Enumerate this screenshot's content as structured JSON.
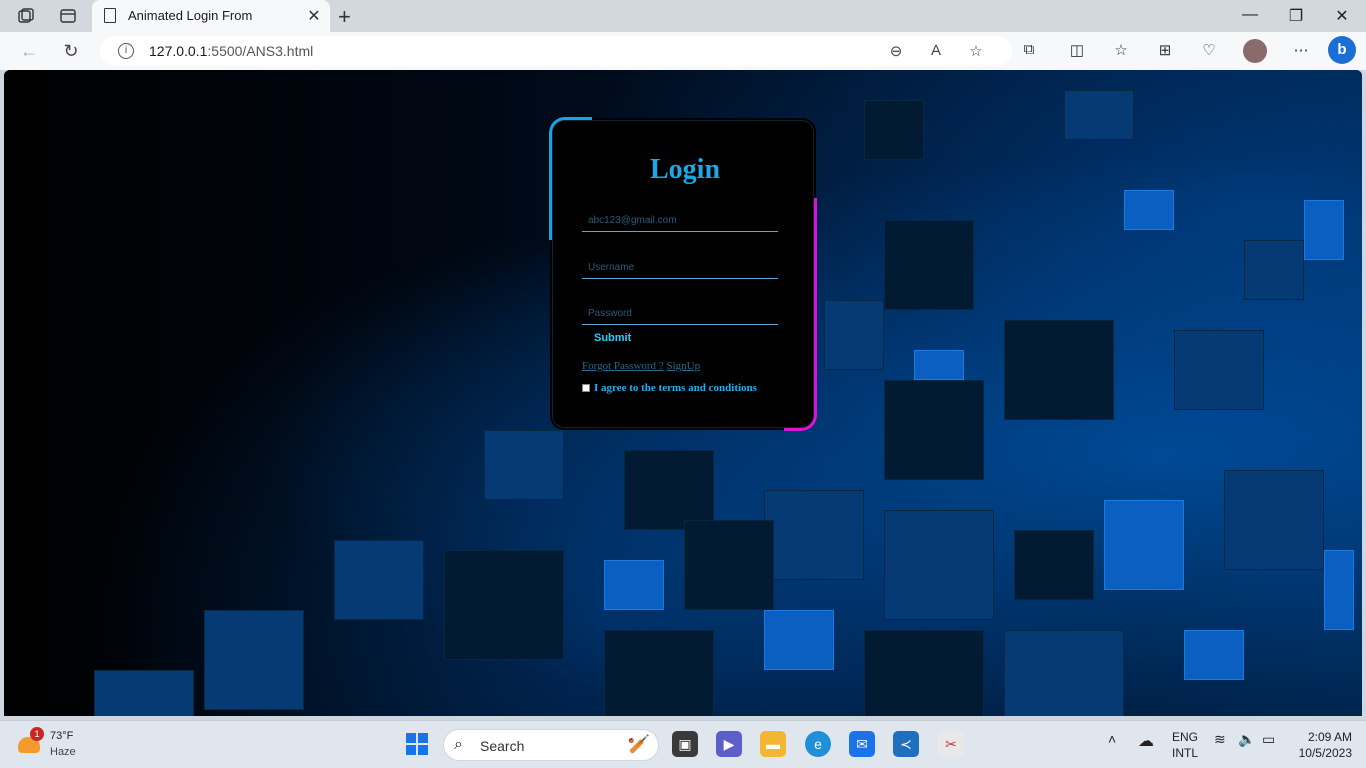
{
  "browser": {
    "tab_title": "Animated Login From",
    "url_host": "127.0.0.1",
    "url_rest": ":5500/ANS3.html"
  },
  "login": {
    "heading": "Login",
    "email_placeholder": "abc123@gmail.com",
    "username_placeholder": "Username",
    "password_placeholder": "Password",
    "submit_label": "Submit",
    "forgot_label": "Forgot Password ?",
    "signup_label": "SignUp",
    "agree_label": "I agree to the terms and conditions"
  },
  "taskbar": {
    "weather_temp": "73°F",
    "weather_cond": "Haze",
    "weather_badge": "1",
    "search_label": "Search",
    "lang_top": "ENG",
    "lang_bottom": "INTL",
    "time": "2:09 AM",
    "date": "10/5/2023"
  },
  "colors": {
    "accent_cyan": "#1ba8e6",
    "accent_magenta": "#d417d4"
  }
}
